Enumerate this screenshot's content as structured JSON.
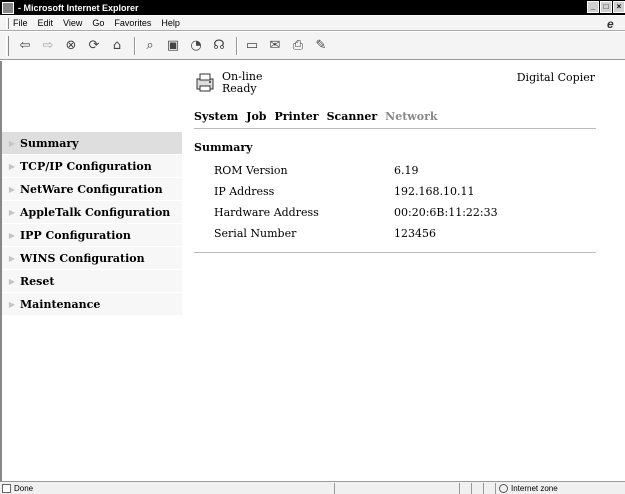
{
  "window": {
    "title": " - Microsoft Internet Explorer",
    "controls": [
      "_",
      "□",
      "×"
    ]
  },
  "menu": {
    "items": [
      "File",
      "Edit",
      "View",
      "Go",
      "Favorites",
      "Help"
    ]
  },
  "toolbar": {
    "icons": [
      "back-icon",
      "forward-icon",
      "stop-icon",
      "refresh-icon",
      "home-icon",
      "search-icon",
      "favorites-icon",
      "history-icon",
      "channels-icon",
      "fullscreen-icon",
      "mail-icon",
      "print-icon",
      "edit-icon"
    ]
  },
  "status": {
    "line1": "On-line",
    "line2": "Ready",
    "device_type": "Digital Copier"
  },
  "tabs": [
    {
      "label": "System",
      "enabled": true
    },
    {
      "label": "Job",
      "enabled": true
    },
    {
      "label": "Printer",
      "enabled": true
    },
    {
      "label": "Scanner",
      "enabled": true
    },
    {
      "label": "Network",
      "enabled": false
    }
  ],
  "sidebar": {
    "items": [
      {
        "label": "Summary",
        "active": true
      },
      {
        "label": "TCP/IP Configuration"
      },
      {
        "label": "NetWare Configuration"
      },
      {
        "label": "AppleTalk Configuration"
      },
      {
        "label": "IPP Configuration"
      },
      {
        "label": "WINS Configuration"
      },
      {
        "label": "Reset"
      },
      {
        "label": "Maintenance"
      }
    ]
  },
  "summary": {
    "title": "Summary",
    "rows": [
      {
        "key": "ROM Version",
        "value": "6.19"
      },
      {
        "key": "IP Address",
        "value": "192.168.10.11"
      },
      {
        "key": "Hardware Address",
        "value": "00:20:6B:11:22:33"
      },
      {
        "key": "Serial Number",
        "value": "123456"
      }
    ]
  },
  "statusbar": {
    "text": "Done",
    "zone": "Internet zone"
  }
}
